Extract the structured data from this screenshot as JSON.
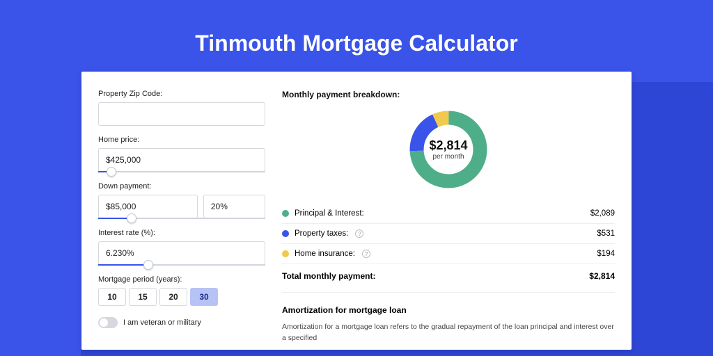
{
  "title": "Tinmouth Mortgage Calculator",
  "form": {
    "zip_label": "Property Zip Code:",
    "zip_value": "",
    "home_price_label": "Home price:",
    "home_price_value": "$425,000",
    "home_price_slider_pct": 8,
    "down_payment_label": "Down payment:",
    "down_payment_value": "$85,000",
    "down_payment_pct_value": "20%",
    "down_payment_slider_pct": 20,
    "interest_label": "Interest rate (%):",
    "interest_value": "6.230%",
    "interest_slider_pct": 30,
    "period_label": "Mortgage period (years):",
    "periods": [
      "10",
      "15",
      "20",
      "30"
    ],
    "period_selected_index": 3,
    "veteran_label": "I am veteran or military"
  },
  "breakdown": {
    "title": "Monthly payment breakdown:",
    "center_value": "$2,814",
    "center_label": "per month",
    "items": [
      {
        "label": "Principal & Interest:",
        "value": "$2,089",
        "color": "#4fae8a",
        "info": false
      },
      {
        "label": "Property taxes:",
        "value": "$531",
        "color": "#3a53e8",
        "info": true
      },
      {
        "label": "Home insurance:",
        "value": "$194",
        "color": "#f0c94d",
        "info": true
      }
    ],
    "total_label": "Total monthly payment:",
    "total_value": "$2,814"
  },
  "amortization": {
    "title": "Amortization for mortgage loan",
    "text": "Amortization for a mortgage loan refers to the gradual repayment of the loan principal and interest over a specified"
  },
  "chart_data": {
    "type": "pie",
    "title": "Monthly payment breakdown",
    "series": [
      {
        "name": "Principal & Interest",
        "value": 2089,
        "color": "#4fae8a"
      },
      {
        "name": "Property taxes",
        "value": 531,
        "color": "#3a53e8"
      },
      {
        "name": "Home insurance",
        "value": 194,
        "color": "#f0c94d"
      }
    ],
    "total": 2814
  }
}
